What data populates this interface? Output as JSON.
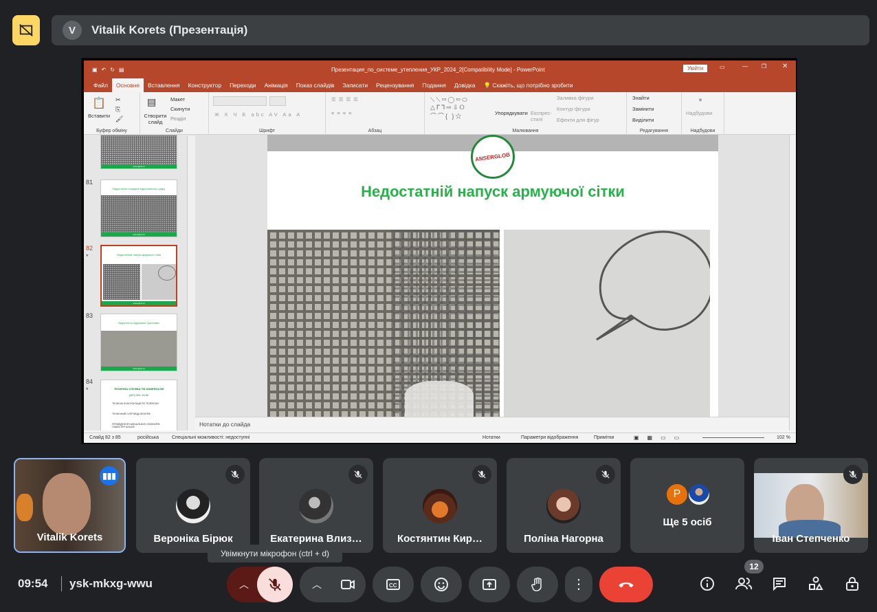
{
  "presenter": {
    "initial": "V",
    "name": "Vitalik Korets (Презентація)"
  },
  "ppt": {
    "title": "Презентация_по_системе_утепления_УКР_2024_2[Compatibility Mode]  -  PowerPoint",
    "signin": "Увійти",
    "tabs": [
      "Файл",
      "Основне",
      "Вставлення",
      "Конструктор",
      "Переходи",
      "Анімація",
      "Показ слайдів",
      "Записати",
      "Рецензування",
      "Подання",
      "Довідка"
    ],
    "tell_me": "Скажіть, що потрібно зробити",
    "ribbon": {
      "paste": "Вставити",
      "clipboard": "Буфер обміну",
      "new_slide": "Створити слайд",
      "layout": "Макет",
      "reset": "Скинути",
      "section": "Розділ",
      "slides": "Слайди",
      "font": "Шрифт",
      "font_btns": "Ж К Ч Б abc AV Aa A",
      "paragraph": "Абзац",
      "arrange": "Упорядкувати",
      "quick_styles": "Експрес-стилі",
      "fill": "Заливка фігури",
      "outline": "Контур фігури",
      "effects": "Ефекти для фігур",
      "drawing": "Малювання",
      "find": "Знайти",
      "replace": "Замінити",
      "select": "Виділити",
      "editing": "Редагування",
      "addins": "Надбудови",
      "addins_group": "Надбудови"
    },
    "thumbs": [
      {
        "num": "81",
        "title": "Недостатня товщина підсилюючого шару",
        "star": ""
      },
      {
        "num": "82",
        "title": "Недостатній напуск армуючої сітки",
        "star": "*"
      },
      {
        "num": "83",
        "title": "Відсутність підрізаної ґрунтовки",
        "star": ""
      },
      {
        "num": "84",
        "title": "ТЕХНІЧНА СЛУЖБА ТМ ANSERGLOB",
        "star": "*"
      }
    ],
    "thumb_footer": "anserglob.ua",
    "thumb84": {
      "phone": "(067) 551-15-60",
      "l1": "ТЕХНІЧНІ КОНСУЛЬТАЦІЇ ПО ТЕЛЕФОНУ",
      "l2": "ТЕХНІЧНИЙ СУПРОВІД ОБ'ЄКТІВ",
      "l3": "ПРОВЕДЕННЯ НАВЧАЛЬНИХ СЕМІНАРІВ І МАЙСТЕР-КЛАСІВ"
    },
    "slide": {
      "logo": "ANSERGLOB",
      "title": "Недостатній напуск армуючої сітки"
    },
    "notes": "Нотатки до слайда",
    "status": {
      "slide": "Слайд 82 з 85",
      "lang": "російська",
      "access": "Спеціальні можливості: недоступні",
      "notes": "Нотатки",
      "display": "Параметри відображення",
      "comments": "Примітки",
      "zoom": "102 %"
    }
  },
  "participants": [
    {
      "name": "Vitalik Korets"
    },
    {
      "name": "Вероніка Бірюк"
    },
    {
      "name": "Екатерина Влиз…"
    },
    {
      "name": "Костянтин Кир…"
    },
    {
      "name": "Поліна Нагорна"
    },
    {
      "name": "Ще 5 осіб",
      "initial": "P"
    },
    {
      "name": "Іван Степченко"
    }
  ],
  "tooltip": "Увімкнути мікрофон (ctrl + d)",
  "bottom": {
    "time": "09:54",
    "code": "ysk-mkxg-wwu",
    "people_count": "12"
  },
  "colors": {
    "accent": "#8ab4f8",
    "present": "#fdd663",
    "end_call": "#ea4335",
    "mic_off": "#f9dedc",
    "ppt": "#b7472a"
  }
}
